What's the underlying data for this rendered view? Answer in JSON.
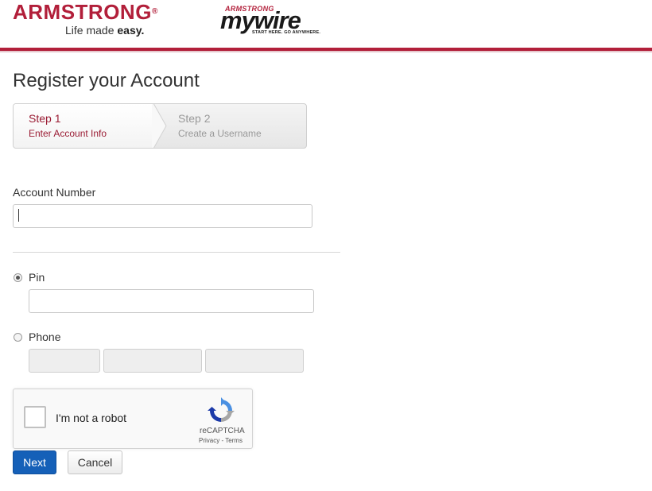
{
  "header": {
    "brand_name": "ARMSTRONG",
    "brand_reg": "®",
    "tagline_prefix": "Life made ",
    "tagline_bold": "easy.",
    "mywire_top": "ARMSTRONG",
    "mywire_main": "mywire",
    "mywire_sub": "START HERE. GO ANYWHERE.",
    "accent_color": "#b21f3a"
  },
  "page": {
    "title": "Register your Account"
  },
  "steps": [
    {
      "number": "Step 1",
      "label": "Enter Account Info",
      "state": "active"
    },
    {
      "number": "Step 2",
      "label": "Create a Username",
      "state": "inactive"
    }
  ],
  "form": {
    "account_number_label": "Account Number",
    "account_number_value": "",
    "pin_label": "Pin",
    "pin_selected": true,
    "pin_value": "",
    "phone_label": "Phone",
    "phone_selected": false
  },
  "captcha": {
    "label": "I'm not a robot",
    "brand": "reCAPTCHA",
    "links": "Privacy - Terms",
    "icon": "recaptcha-logo-icon"
  },
  "buttons": {
    "next": "Next",
    "cancel": "Cancel",
    "primary_color": "#1560b8"
  }
}
